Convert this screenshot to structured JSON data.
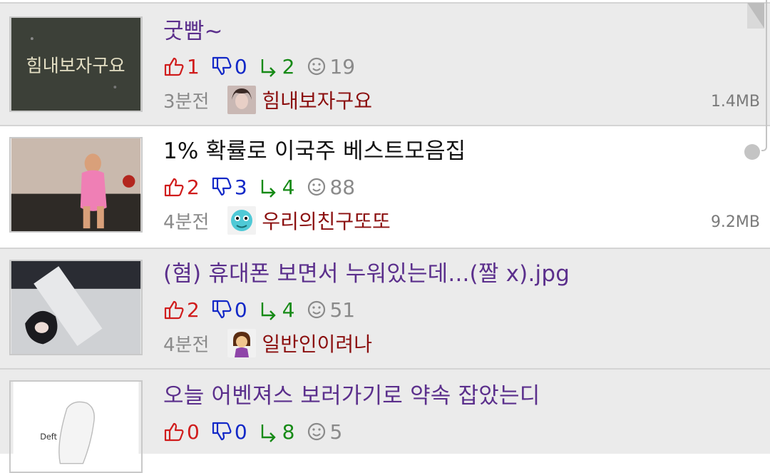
{
  "colors": {
    "visited_title": "#5b2f8c",
    "upvote": "#d01c1c",
    "downvote": "#1228c7",
    "share": "#168a16",
    "comment": "#8a8a8a",
    "author": "#8b0f0f",
    "read_row_bg": "#ebebeb",
    "current_row_bg": "#ffffff"
  },
  "posts": [
    {
      "title": "굿빰~",
      "upvotes": "1",
      "downvotes": "0",
      "shares": "2",
      "comments": "19",
      "time": "3분전",
      "author": "힘내보자구요",
      "size": "1.4MB",
      "thumb_text": "힘내보자구요",
      "read": true
    },
    {
      "title": "1% 확률로 이국주 베스트모음집",
      "upvotes": "2",
      "downvotes": "3",
      "shares": "4",
      "comments": "88",
      "time": "4분전",
      "author": "우리의친구또또",
      "size": "9.2MB",
      "read": false
    },
    {
      "title": "(혐) 휴대폰 보면서 누워있는데...(짤 x).jpg",
      "upvotes": "2",
      "downvotes": "0",
      "shares": "4",
      "comments": "51",
      "time": "4분전",
      "author": "일반인이려나",
      "read": true
    },
    {
      "title": "오늘 어벤져스 보러가기로 약속 잡았는디",
      "upvotes": "0",
      "downvotes": "0",
      "shares": "8",
      "comments": "5",
      "thumb_text": "Deft",
      "read": true
    }
  ]
}
